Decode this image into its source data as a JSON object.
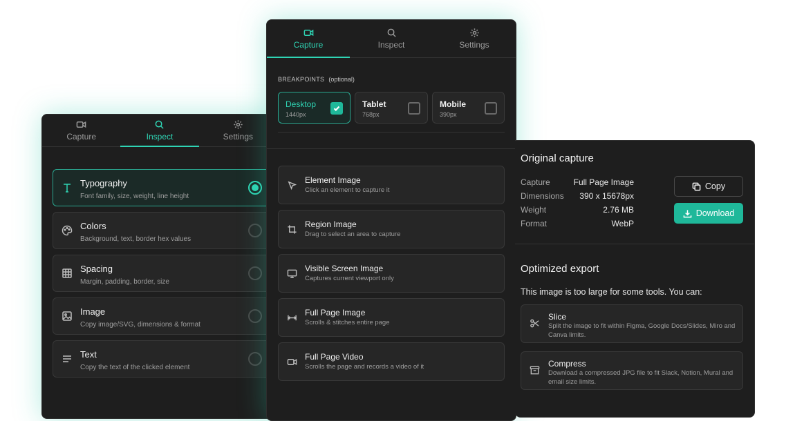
{
  "colors": {
    "accent": "#2fd4b4",
    "panel": "#1e1e1e",
    "card": "#262626",
    "button_primary": "#1fb89a"
  },
  "left_panel": {
    "tabs": [
      {
        "label": "Capture",
        "icon": "video-icon"
      },
      {
        "label": "Inspect",
        "icon": "search-icon",
        "active": true
      },
      {
        "label": "Settings",
        "icon": "gear-icon"
      }
    ],
    "options": [
      {
        "title": "Typography",
        "desc": "Font family, size, weight, line height",
        "icon": "type-icon",
        "selected": true
      },
      {
        "title": "Colors",
        "desc": "Background, text, border hex values",
        "icon": "palette-icon"
      },
      {
        "title": "Spacing",
        "desc": "Margin, padding, border, size",
        "icon": "grid-icon"
      },
      {
        "title": "Image",
        "desc": "Copy image/SVG, dimensions & format",
        "icon": "image-icon"
      },
      {
        "title": "Text",
        "desc": "Copy the text of the clicked element",
        "icon": "text-lines-icon"
      }
    ]
  },
  "middle_panel": {
    "tabs": [
      {
        "label": "Capture",
        "icon": "video-icon",
        "active": true
      },
      {
        "label": "Inspect",
        "icon": "search-icon"
      },
      {
        "label": "Settings",
        "icon": "gear-icon"
      }
    ],
    "breakpoints_label": "BREAKPOINTS",
    "breakpoints_optional": "(optional)",
    "breakpoints": [
      {
        "name": "Desktop",
        "size": "1440px",
        "checked": true
      },
      {
        "name": "Tablet",
        "size": "768px",
        "checked": false
      },
      {
        "name": "Mobile",
        "size": "390px",
        "checked": false
      }
    ],
    "actions": [
      {
        "title": "Element Image",
        "desc": "Click an element to capture it",
        "icon": "cursor-icon"
      },
      {
        "title": "Region Image",
        "desc": "Drag to select an area to capture",
        "icon": "crop-icon"
      },
      {
        "title": "Visible Screen Image",
        "desc": "Captures current viewport only",
        "icon": "monitor-icon"
      },
      {
        "title": "Full Page Image",
        "desc": "Scrolls & stitches entire page",
        "icon": "stretch-icon"
      },
      {
        "title": "Full Page Video",
        "desc": "Scrolls the page and records a video of it",
        "icon": "video-icon"
      }
    ]
  },
  "right_panel": {
    "original_title": "Original capture",
    "details": [
      {
        "key": "Capture",
        "value": "Full Page Image"
      },
      {
        "key": "Dimensions",
        "value": "390 x 15678px"
      },
      {
        "key": "Weight",
        "value": "2.76 MB"
      },
      {
        "key": "Format",
        "value": "WebP"
      }
    ],
    "copy_label": "Copy",
    "download_label": "Download",
    "optimized_title": "Optimized export",
    "note": "This image is too large for some tools. You can:",
    "exports": [
      {
        "title": "Slice",
        "desc": "Split the image to fit within Figma, Google Docs/Slides, Miro and Canva limits.",
        "icon": "scissors-icon"
      },
      {
        "title": "Compress",
        "desc": "Download a compressed JPG file to fit Slack, Notion, Mural and email size limits.",
        "icon": "archive-icon"
      }
    ]
  }
}
